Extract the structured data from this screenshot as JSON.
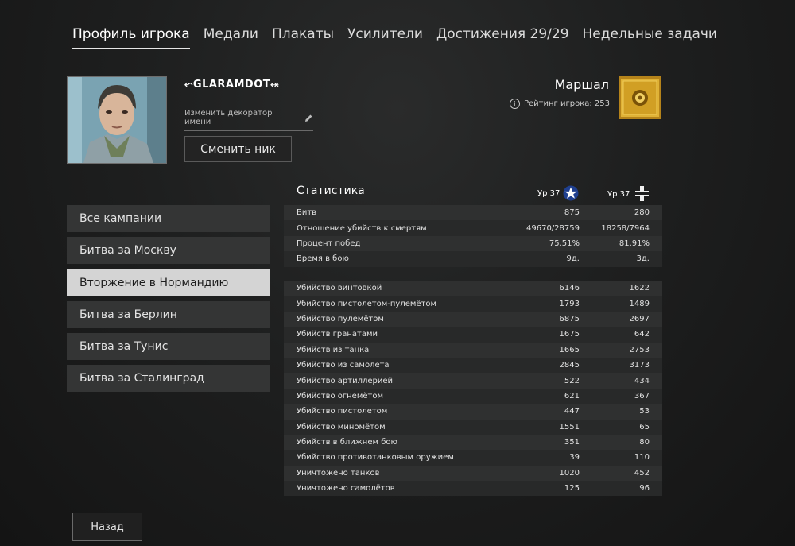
{
  "tabs": [
    "Профиль игрока",
    "Медали",
    "Плакаты",
    "Усилители",
    "Достижения 29/29",
    "Недельные задачи"
  ],
  "profile": {
    "nickname": "GLARAMDOT",
    "decorator_label": "Изменить декоратор имени",
    "change_nick_label": "Сменить ник",
    "rank": "Маршал",
    "rating_label": "Рейтинг игрока: 253"
  },
  "campaigns": [
    "Все кампании",
    "Битва за Москву",
    "Вторжение в Нормандию",
    "Битва за Берлин",
    "Битва за Тунис",
    "Битва за Сталинград"
  ],
  "selected_campaign": 2,
  "stats": {
    "title": "Статистика",
    "allies_level": "Ур 37",
    "axis_level": "Ур 37",
    "general": [
      {
        "label": "Битв",
        "a": "875",
        "b": "280"
      },
      {
        "label": "Отношение убийств к смертям",
        "a": "49670/28759",
        "b": "18258/7964"
      },
      {
        "label": "Процент побед",
        "a": "75.51%",
        "b": "81.91%"
      },
      {
        "label": "Время в бою",
        "a": "9д.",
        "b": "3д."
      }
    ],
    "kills": [
      {
        "label": "Убийство винтовкой",
        "a": "6146",
        "b": "1622"
      },
      {
        "label": "Убийство пистолетом-пулемётом",
        "a": "1793",
        "b": "1489"
      },
      {
        "label": "Убийство пулемётом",
        "a": "6875",
        "b": "2697"
      },
      {
        "label": "Убийств гранатами",
        "a": "1675",
        "b": "642"
      },
      {
        "label": "Убийств из танка",
        "a": "1665",
        "b": "2753"
      },
      {
        "label": "Убийство из самолета",
        "a": "2845",
        "b": "3173"
      },
      {
        "label": "Убийство артиллерией",
        "a": "522",
        "b": "434"
      },
      {
        "label": "Убийство огнемётом",
        "a": "621",
        "b": "367"
      },
      {
        "label": "Убийство пистолетом",
        "a": "447",
        "b": "53"
      },
      {
        "label": "Убийство миномётом",
        "a": "1551",
        "b": "65"
      },
      {
        "label": "Убийств в ближнем бою",
        "a": "351",
        "b": "80"
      },
      {
        "label": "Убийство противотанковым оружием",
        "a": "39",
        "b": "110"
      },
      {
        "label": "Уничтожено танков",
        "a": "1020",
        "b": "452"
      },
      {
        "label": "Уничтожено самолётов",
        "a": "125",
        "b": "96"
      }
    ]
  },
  "back_label": "Назад",
  "icons": {
    "allies": "star-icon",
    "axis": "balkenkreuz-icon",
    "pencil": "pencil-icon",
    "info": "info-icon"
  },
  "colors": {
    "active_tab_underline": "#e6e6e6",
    "selected_campaign": "#d4d4d4",
    "allies_blue": "#1f3f8f",
    "badge_gold": "#d9a72a"
  }
}
